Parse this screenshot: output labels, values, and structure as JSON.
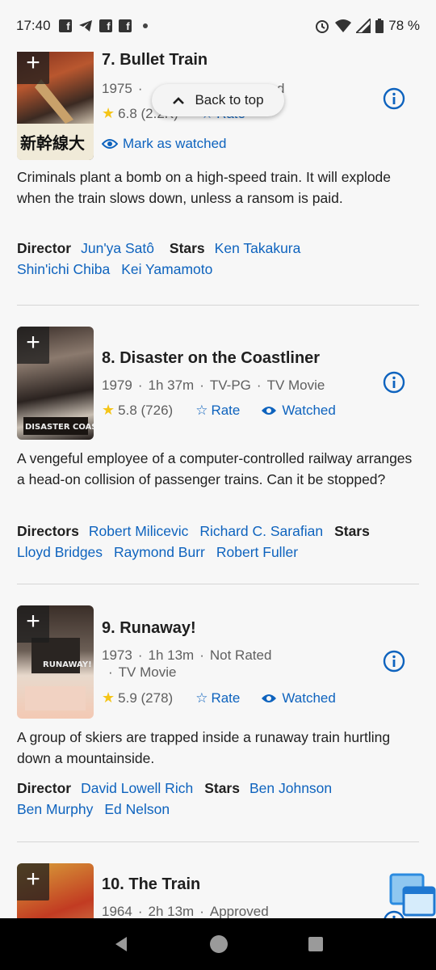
{
  "status_bar": {
    "time": "17:40",
    "battery": "78 %",
    "icons": [
      "facebook-icon",
      "telegram-icon",
      "facebook-icon",
      "facebook-icon",
      "dot",
      "alarm-icon",
      "wifi-icon",
      "signal-icon",
      "battery-icon"
    ]
  },
  "back_to_top": {
    "label": "Back to top"
  },
  "items": [
    {
      "title": "7. Bullet Train",
      "year": "1975",
      "meta_hidden_tail": "ed",
      "rating": "6.8",
      "votes": "(2.2K)",
      "rate_label": "Rate",
      "mark_watched_label": "Mark as watched",
      "description": "Criminals plant a bomb on a high-speed train. It will explode when the train slows down, unless a ransom is paid.",
      "director_label": "Director",
      "directors": [
        "Jun'ya Satô"
      ],
      "stars_label": "Stars",
      "stars": [
        "Ken Takakura",
        "Shin'ichi Chiba",
        "Kei Yamamoto"
      ]
    },
    {
      "title": "8. Disaster on the Coastliner",
      "year": "1979",
      "runtime": "1h 37m",
      "cert": "TV-PG",
      "type": "TV Movie",
      "rating": "5.8",
      "votes": "(726)",
      "rate_label": "Rate",
      "watched_label": "Watched",
      "description": "A vengeful employee of a computer-controlled railway arranges a head-on collision of passenger trains. Can it be stopped?",
      "director_label": "Directors",
      "directors": [
        "Robert Milicevic",
        "Richard C. Sarafian"
      ],
      "stars_label": "Stars",
      "stars": [
        "Lloyd Bridges",
        "Raymond Burr",
        "Robert Fuller"
      ]
    },
    {
      "title": "9. Runaway!",
      "year": "1973",
      "runtime": "1h 13m",
      "cert": "Not Rated",
      "type": "TV Movie",
      "rating": "5.9",
      "votes": "(278)",
      "rate_label": "Rate",
      "watched_label": "Watched",
      "description": "A group of skiers are trapped inside a runaway train hurtling down a mountainside.",
      "director_label": "Director",
      "directors": [
        "David Lowell Rich"
      ],
      "stars_label": "Stars",
      "stars": [
        "Ben Johnson",
        "Ben Murphy",
        "Ed Nelson"
      ]
    },
    {
      "title": "10. The Train",
      "year": "1964",
      "runtime": "2h 13m",
      "cert": "Approved"
    }
  ],
  "colors": {
    "link": "#0e63be",
    "star": "#f5c518",
    "background": "#f7f7f7"
  }
}
